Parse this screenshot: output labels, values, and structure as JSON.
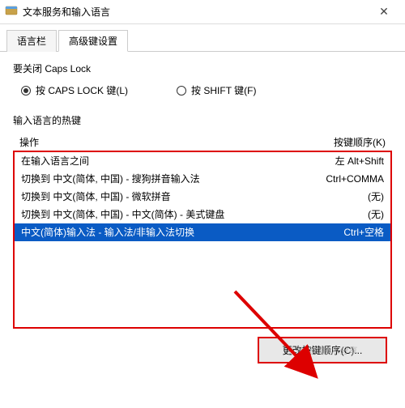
{
  "window": {
    "title": "文本服务和输入语言"
  },
  "tabs": {
    "items": [
      {
        "label": "语言栏"
      },
      {
        "label": "高级键设置"
      }
    ]
  },
  "capslock": {
    "group_label": "要关闭 Caps Lock",
    "option1": "按 CAPS LOCK 键(L)",
    "option2": "按 SHIFT 键(F)"
  },
  "hotkeys": {
    "group_label": "输入语言的热键",
    "col_action": "操作",
    "col_keys": "按键顺序(K)",
    "rows": [
      {
        "action": "在输入语言之间",
        "keys": "左 Alt+Shift"
      },
      {
        "action": "切换到 中文(简体, 中国) - 搜狗拼音输入法",
        "keys": "Ctrl+COMMA"
      },
      {
        "action": "切换到 中文(简体, 中国) - 微软拼音",
        "keys": "(无)"
      },
      {
        "action": "切换到 中文(简体, 中国) - 中文(简体) - 美式键盘",
        "keys": "(无)"
      },
      {
        "action": "中文(简体)输入法 - 输入法/非输入法切换",
        "keys": "Ctrl+空格"
      }
    ]
  },
  "buttons": {
    "change_seq": "更改按键顺序(C)..."
  },
  "watermark": "头条@IT技术分享"
}
